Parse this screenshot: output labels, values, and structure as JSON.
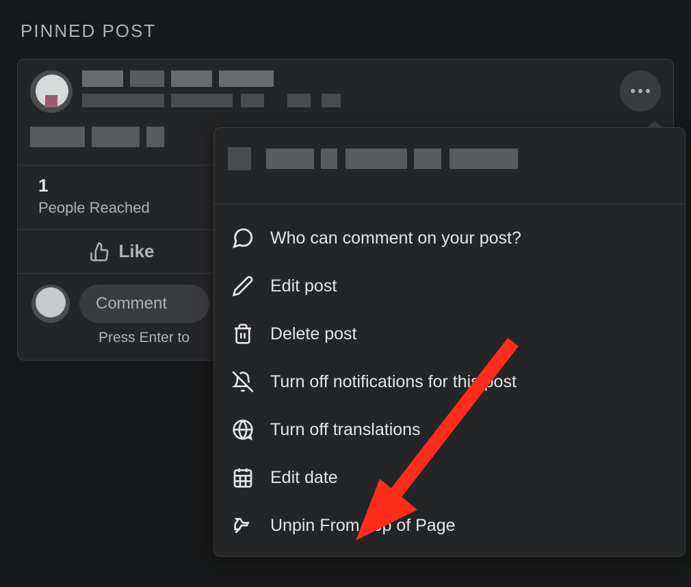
{
  "section_header": "PINNED POST",
  "stats": {
    "count": "1",
    "label": "People Reached"
  },
  "like_label": "Like",
  "comment_placeholder": "Comment",
  "comment_hint": "Press Enter to",
  "menu": {
    "items": [
      {
        "label": "Who can comment on your post?"
      },
      {
        "label": "Edit post"
      },
      {
        "label": "Delete post"
      },
      {
        "label": "Turn off notifications for this post"
      },
      {
        "label": "Turn off translations"
      },
      {
        "label": "Edit date"
      },
      {
        "label": "Unpin From Top of Page"
      }
    ]
  }
}
